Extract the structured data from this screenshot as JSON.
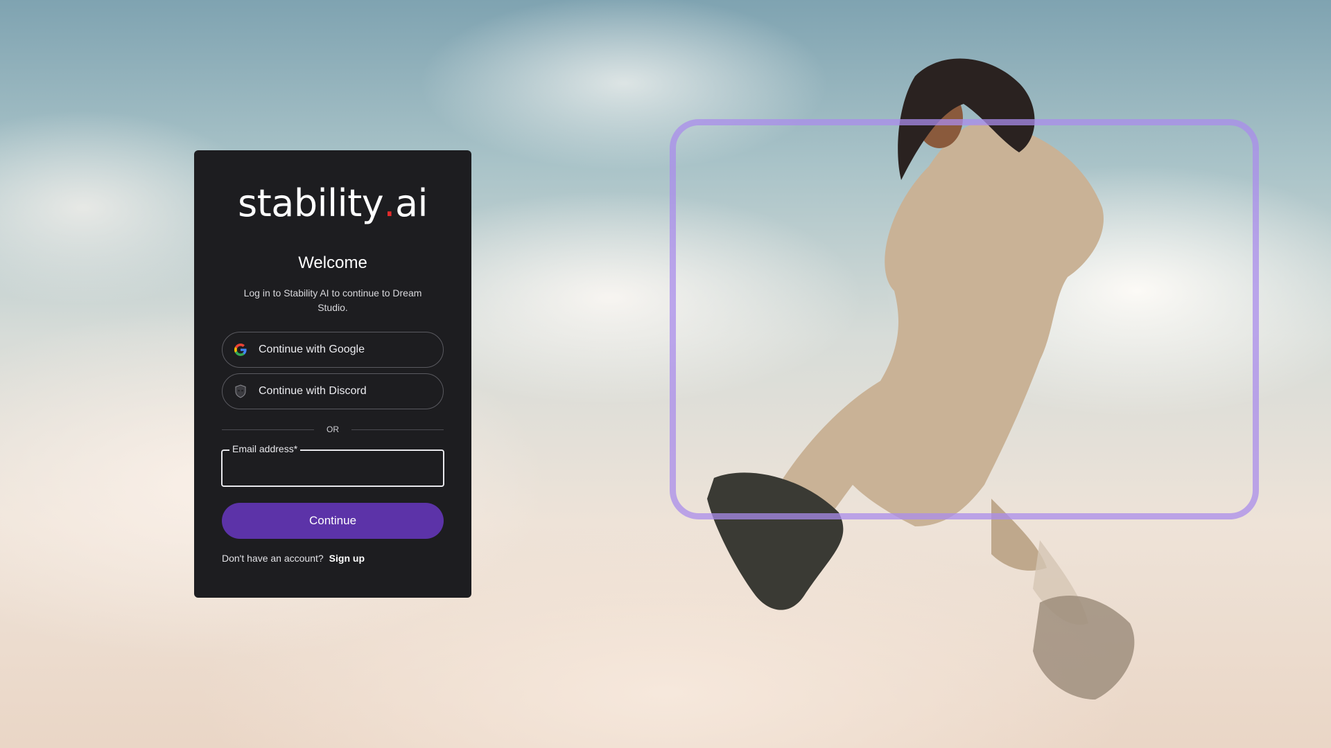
{
  "logo": {
    "text_main": "stability",
    "text_dot": ".",
    "text_suffix": "ai"
  },
  "heading": "Welcome",
  "subtitle": "Log in to Stability AI to continue to Dream Studio.",
  "social": {
    "google": {
      "label": "Continue with Google",
      "icon": "google-icon"
    },
    "discord": {
      "label": "Continue with Discord",
      "icon": "discord-icon"
    }
  },
  "divider": "OR",
  "email": {
    "label": "Email address*",
    "value": "",
    "placeholder": ""
  },
  "continue_label": "Continue",
  "signup": {
    "prompt": "Don't have an account?",
    "link": "Sign up"
  },
  "colors": {
    "accent": "#5c33a8",
    "card": "#1d1d20",
    "logo_dot": "#e22b2b",
    "frame": "#aa8ceb"
  }
}
